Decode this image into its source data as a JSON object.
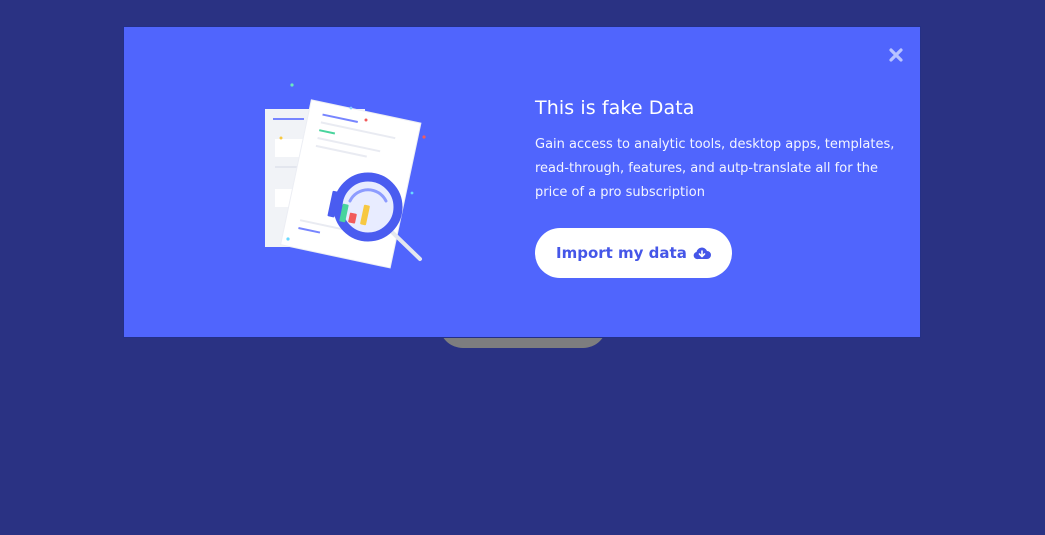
{
  "modal": {
    "title": "This is fake Data",
    "description": "Gain access to analytic tools, desktop apps, templates, read-through, features, and autp-translate all for the price of a pro subscription",
    "primary_button": {
      "label": "Import my data",
      "icon": "cloud-download-icon"
    },
    "close_icon": "close-icon",
    "illustration": "analytics-report-magnifier-illustration"
  },
  "colors": {
    "page_background": "#2a3283",
    "modal_background": "#5065fd",
    "button_background": "#ffffff",
    "button_text": "#4556e8",
    "bar_blue": "#4a5cf0",
    "bar_red": "#f25b5b",
    "bar_yellow": "#f7c841",
    "bar_green": "#49d49d"
  }
}
